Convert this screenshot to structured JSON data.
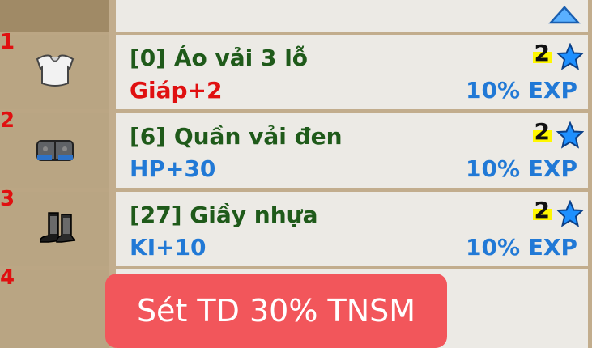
{
  "items": [
    {
      "slot": "1",
      "name": "[0] Áo vải 3 lỗ",
      "stat": "Giáp+2",
      "stat_color": "#e01010",
      "level": "2",
      "exp": "10% EXP",
      "icon": "shirt-icon"
    },
    {
      "slot": "2",
      "name": "[6] Quần vải đen",
      "stat": "HP+30",
      "stat_color": "#2179d6",
      "level": "2",
      "exp": "10% EXP",
      "icon": "pants-icon"
    },
    {
      "slot": "3",
      "name": "[27] Giầy nhựa",
      "stat": "KI+10",
      "stat_color": "#2179d6",
      "level": "2",
      "exp": "10% EXP",
      "icon": "boots-icon"
    },
    {
      "slot": "4"
    }
  ],
  "toast": {
    "text": "Sét TD 30% TNSM"
  },
  "colors": {
    "name": "#1f5a1a",
    "exp": "#2179d6",
    "star": "#1e90ff",
    "toast_bg": "#f2565b"
  }
}
